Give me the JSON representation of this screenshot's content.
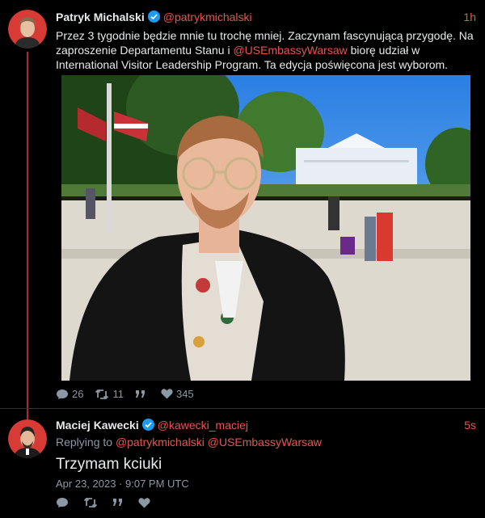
{
  "tweet1": {
    "name": "Patryk Michalski",
    "handle": "@patrykmichalski",
    "time": "1h",
    "text_1": "Przez 3 tygodnie będzie mnie tu trochę mniej. Zaczynam fascynującą przygodę. Na zaproszenie Departamentu Stanu i ",
    "mention": "@USEmbassyWarsaw",
    "text_2": " biorę udział w International Visitor Leadership Program. Ta edycja poświęcona jest wyborom.",
    "replies": "26",
    "retweets": "11",
    "likes": "345"
  },
  "tweet2": {
    "name": "Maciej Kawecki",
    "handle": "@kawecki_maciej",
    "time": "5s",
    "replying_prefix": "Replying to ",
    "replying_1": "@patrykmichalski",
    "replying_2": "@USEmbassyWarsaw",
    "text": "Trzymam kciuki",
    "date": "Apr 23, 2023 · 9:07 PM UTC"
  },
  "colors": {
    "accent": "#e8554f",
    "verified": "#1d9bf0",
    "background": "#000000",
    "muted": "#8b98a5"
  },
  "icons": [
    "verified-icon",
    "reply-icon",
    "retweet-icon",
    "quote-icon",
    "like-icon"
  ]
}
